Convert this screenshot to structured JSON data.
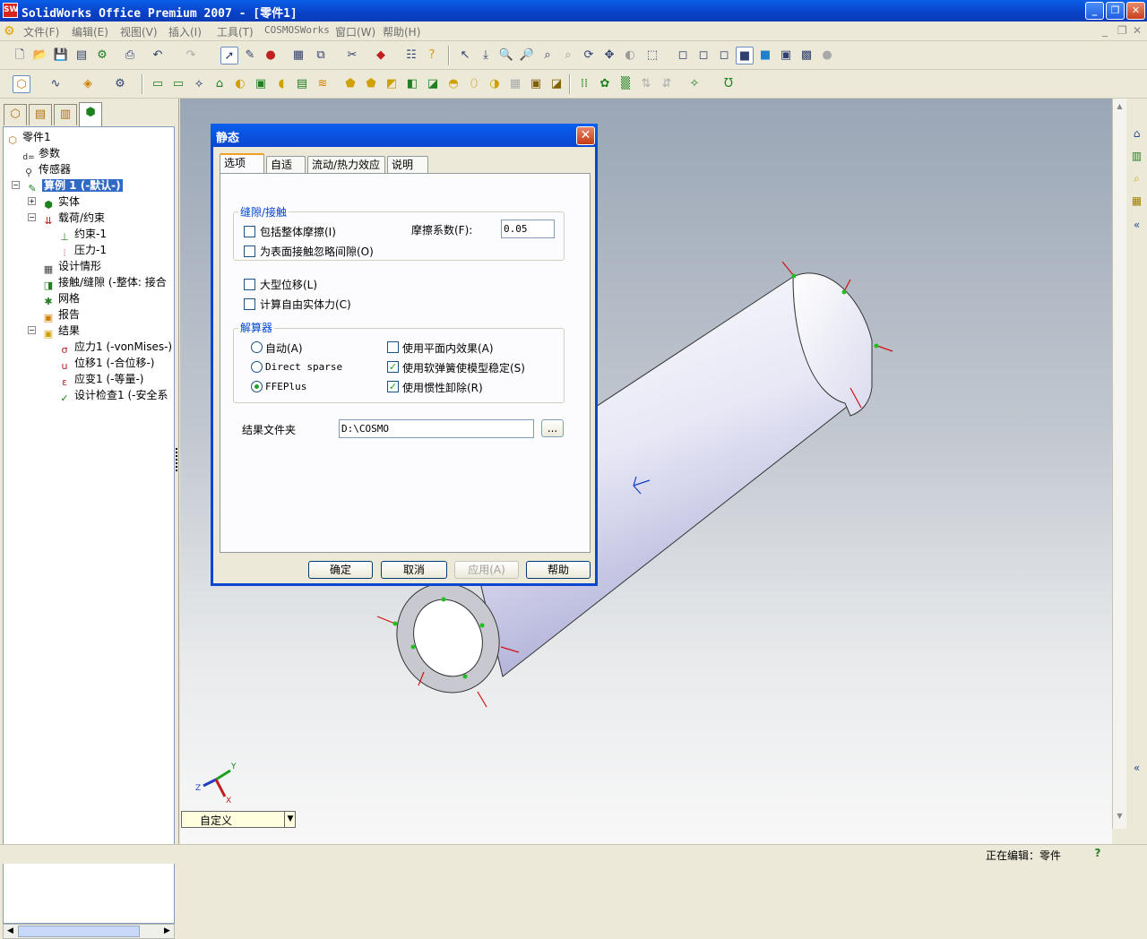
{
  "window": {
    "title": "SolidWorks Office Premium 2007 - [零件1]",
    "app_icon": "SW"
  },
  "menu": [
    "文件(F)",
    "编辑(E)",
    "视图(V)",
    "插入(I)",
    "工具(T)",
    "COSMOSWorks",
    "窗口(W)",
    "帮助(H)"
  ],
  "panel_tabs": [
    "feature-manager-icon",
    "property-manager-icon",
    "configuration-manager-icon",
    "cosmos-manager-icon"
  ],
  "tree": {
    "root": "零件1",
    "params": "参数",
    "sensors": "传感器",
    "study": "算例 1 (-默认-)",
    "solids": "实体",
    "loads": "载荷/约束",
    "fixture": "约束-1",
    "pressure": "压力-1",
    "scenario": "设计情形",
    "contact": "接触/缝隙 (-整体: 接合",
    "mesh": "网格",
    "report": "报告",
    "results": "结果",
    "stress": "应力1 (-vonMises-)",
    "displacement": "位移1 (-合位移-)",
    "strain": "应变1 (-等量-)",
    "check": "设计检查1 (-安全系"
  },
  "view_dropdown": "自定义",
  "triad": {
    "x": "X",
    "y": "Y",
    "z": "Z"
  },
  "statusbar": {
    "editing": "正在编辑：零件",
    "help": "?"
  },
  "dialog": {
    "title": "静态",
    "tabs": [
      "选项",
      "自适应",
      "流动/热力效应",
      "说明"
    ],
    "gap_group": "缝隙/接触",
    "include_friction": "包括整体摩擦(I)",
    "ignore_gap": "为表面接触忽略间隙(O)",
    "friction_label": "摩擦系数(F):",
    "friction_value": "0.05",
    "large_disp": "大型位移(L)",
    "free_body": "计算自由实体力(C)",
    "solver_group": "解算器",
    "auto": "自动(A)",
    "direct_sparse": "Direct sparse",
    "ffeplus": "FFEPlus",
    "inplane": "使用平面内效果(A)",
    "soft_spring": "使用软弹簧使模型稳定(S)",
    "inertial_relief": "使用惯性卸除(R)",
    "results_folder_label": "结果文件夹",
    "results_folder_value": "D:\\COSMO",
    "browse": "...",
    "ok": "确定",
    "cancel": "取消",
    "apply": "应用(A)",
    "help": "帮助",
    "state": {
      "include_friction": false,
      "ignore_gap": false,
      "large_disp": false,
      "free_body": false,
      "solver": "FFEPlus",
      "inplane": false,
      "soft_spring": true,
      "inertial_relief": true
    }
  },
  "colors": {
    "title_blue": "#0a46d0",
    "accent_green": "#21a121",
    "load_arrow": "#d01010"
  }
}
